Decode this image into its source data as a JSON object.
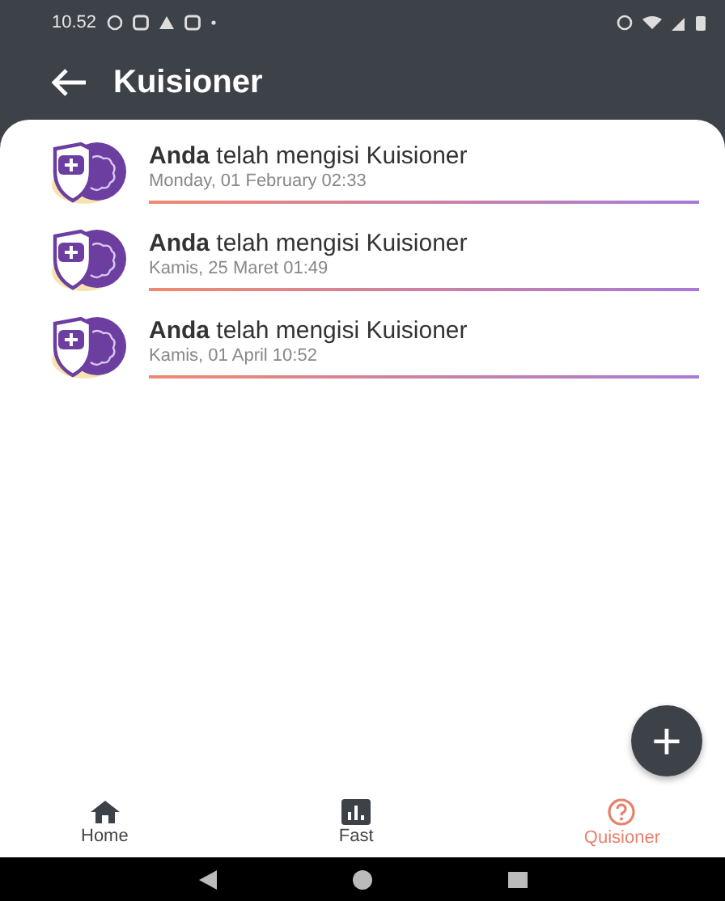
{
  "status_bar": {
    "time": "10.52"
  },
  "header": {
    "title": "Kuisioner"
  },
  "entries": [
    {
      "title": "**Anda** telah mengisi Kuisioner",
      "date": "Monday, 01 February 02:33"
    },
    {
      "title": "**Anda** telah mengisi Kuisioner",
      "date": "Kamis, 25 Maret 01:49"
    },
    {
      "title": "**Anda** telah mengisi Kuisioner",
      "date": "Kamis, 01 April 10:52"
    }
  ],
  "fab": {
    "label": "+"
  },
  "bottom_nav": [
    {
      "label": "Home",
      "kind": "home",
      "selected": false
    },
    {
      "label": "Fast",
      "kind": "chart",
      "selected": false
    },
    {
      "label": "Quisioner",
      "kind": "help",
      "selected": true
    }
  ]
}
